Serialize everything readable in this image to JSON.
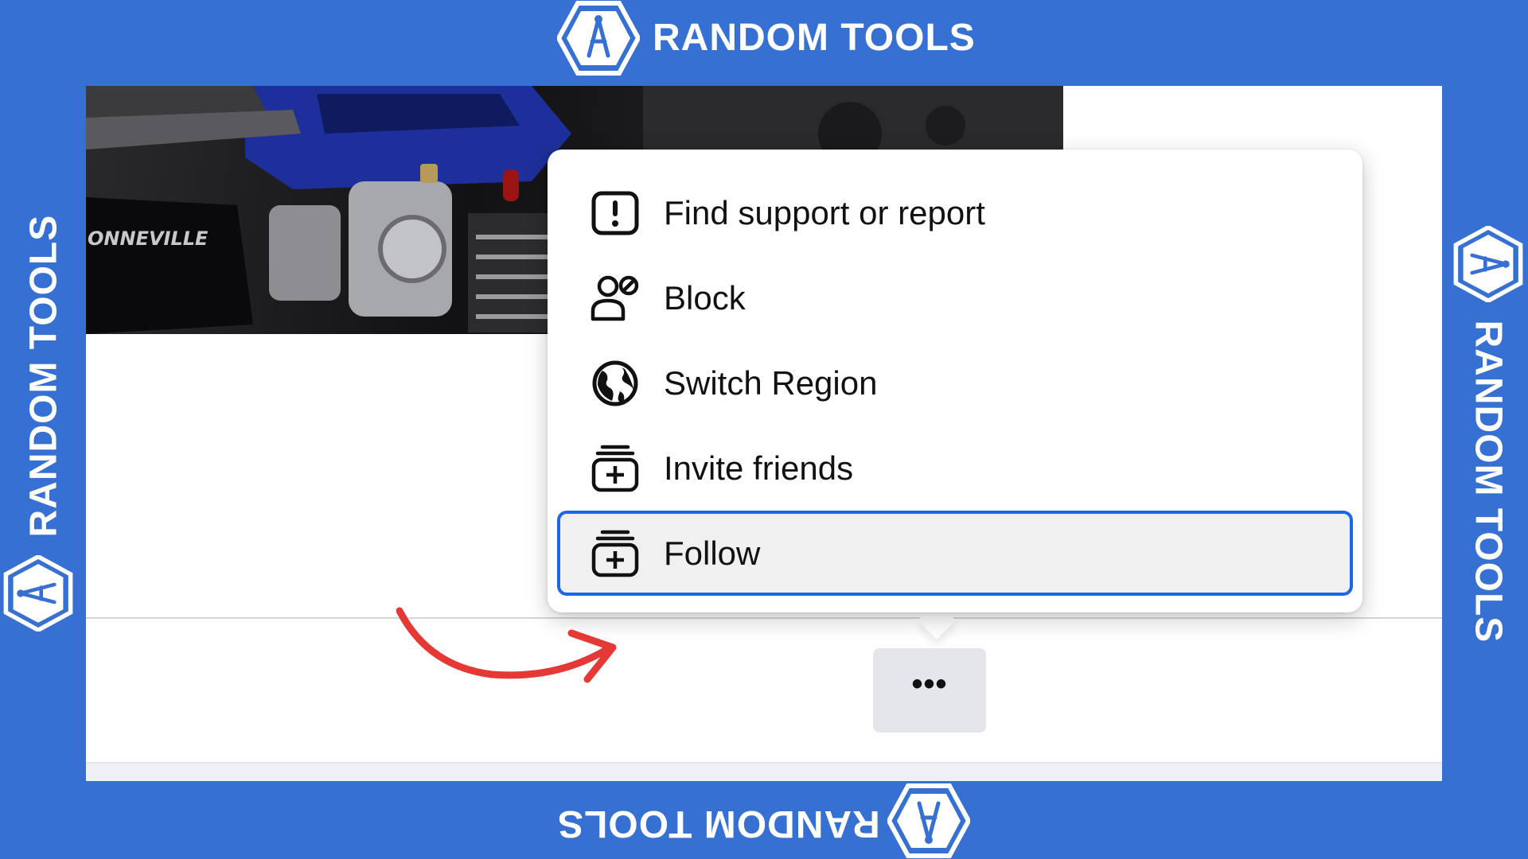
{
  "brand": {
    "name": "RANDOM TOOLS",
    "color": "#3570d2"
  },
  "menu": {
    "items": [
      {
        "label": "Find support or report",
        "icon": "report-icon"
      },
      {
        "label": "Block",
        "icon": "block-user-icon"
      },
      {
        "label": "Switch Region",
        "icon": "globe-icon"
      },
      {
        "label": "Invite friends",
        "icon": "invite-icon"
      },
      {
        "label": "Follow",
        "icon": "follow-icon",
        "highlighted": true
      }
    ],
    "highlight_color": "#1b67e6"
  },
  "more_button": {
    "label": "•••"
  },
  "cover": {
    "overlay_text": "ONNEVILLE"
  },
  "annotation": {
    "arrow_color": "#e53935"
  }
}
